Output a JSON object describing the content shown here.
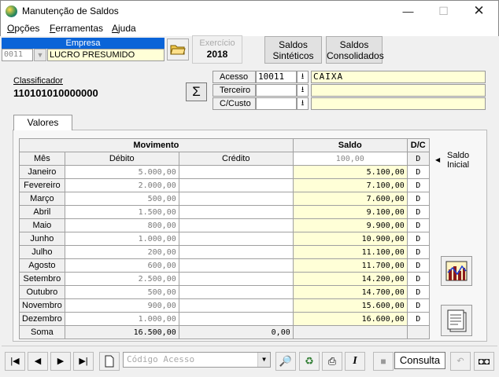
{
  "window": {
    "title": "Manutenção de Saldos",
    "minimize": "—",
    "maximize": "☐",
    "close": "✕"
  },
  "menu": [
    {
      "label": "Opções",
      "underline_char": "O"
    },
    {
      "label": "Ferramentas",
      "underline_char": "F"
    },
    {
      "label": "Ajuda",
      "underline_char": "A"
    }
  ],
  "empresa": {
    "header": "Empresa",
    "code": "0011",
    "name": "LUCRO PRESUMIDO"
  },
  "exercicio": {
    "label": "Exercício",
    "value": "2018"
  },
  "buttons": {
    "saldos_sinteticos": [
      "Saldos",
      "Sintéticos"
    ],
    "saldos_consolidados": [
      "Saldos",
      "Consolidados"
    ]
  },
  "classificador": {
    "label": "Classificador",
    "value": "110101010000000"
  },
  "account": {
    "rows": [
      {
        "label": "Acesso",
        "value": "10011",
        "desc": "CAIXA"
      },
      {
        "label": "Terceiro",
        "value": "",
        "desc": ""
      },
      {
        "label": "C/Custo",
        "value": "",
        "desc": ""
      }
    ]
  },
  "tab": {
    "label": "Valores"
  },
  "grid": {
    "group_headers": {
      "movimento": "Movimento",
      "saldo": "Saldo",
      "dc": "D/C"
    },
    "sub_headers": {
      "mes": "Mês",
      "debito": "Débito",
      "credito": "Crédito"
    },
    "initial": {
      "saldo": "100,00",
      "dc": "D"
    },
    "rows": [
      {
        "mes": "Janeiro",
        "debito": "5.000,00",
        "credito": "",
        "saldo": "5.100,00",
        "dc": "D"
      },
      {
        "mes": "Fevereiro",
        "debito": "2.000,00",
        "credito": "",
        "saldo": "7.100,00",
        "dc": "D"
      },
      {
        "mes": "Março",
        "debito": "500,00",
        "credito": "",
        "saldo": "7.600,00",
        "dc": "D"
      },
      {
        "mes": "Abril",
        "debito": "1.500,00",
        "credito": "",
        "saldo": "9.100,00",
        "dc": "D"
      },
      {
        "mes": "Maio",
        "debito": "800,00",
        "credito": "",
        "saldo": "9.900,00",
        "dc": "D"
      },
      {
        "mes": "Junho",
        "debito": "1.000,00",
        "credito": "",
        "saldo": "10.900,00",
        "dc": "D"
      },
      {
        "mes": "Julho",
        "debito": "200,00",
        "credito": "",
        "saldo": "11.100,00",
        "dc": "D"
      },
      {
        "mes": "Agosto",
        "debito": "600,00",
        "credito": "",
        "saldo": "11.700,00",
        "dc": "D"
      },
      {
        "mes": "Setembro",
        "debito": "2.500,00",
        "credito": "",
        "saldo": "14.200,00",
        "dc": "D"
      },
      {
        "mes": "Outubro",
        "debito": "500,00",
        "credito": "",
        "saldo": "14.700,00",
        "dc": "D"
      },
      {
        "mes": "Novembro",
        "debito": "900,00",
        "credito": "",
        "saldo": "15.600,00",
        "dc": "D"
      },
      {
        "mes": "Dezembro",
        "debito": "1.000,00",
        "credito": "",
        "saldo": "16.600,00",
        "dc": "D"
      }
    ],
    "total": {
      "label": "Soma",
      "debito": "16.500,00",
      "credito": "0,00"
    }
  },
  "saldo_inicial_label": [
    "Saldo",
    "Inicial"
  ],
  "toolbar": {
    "code_placeholder": "Código Acesso",
    "mode": "Consulta"
  }
}
